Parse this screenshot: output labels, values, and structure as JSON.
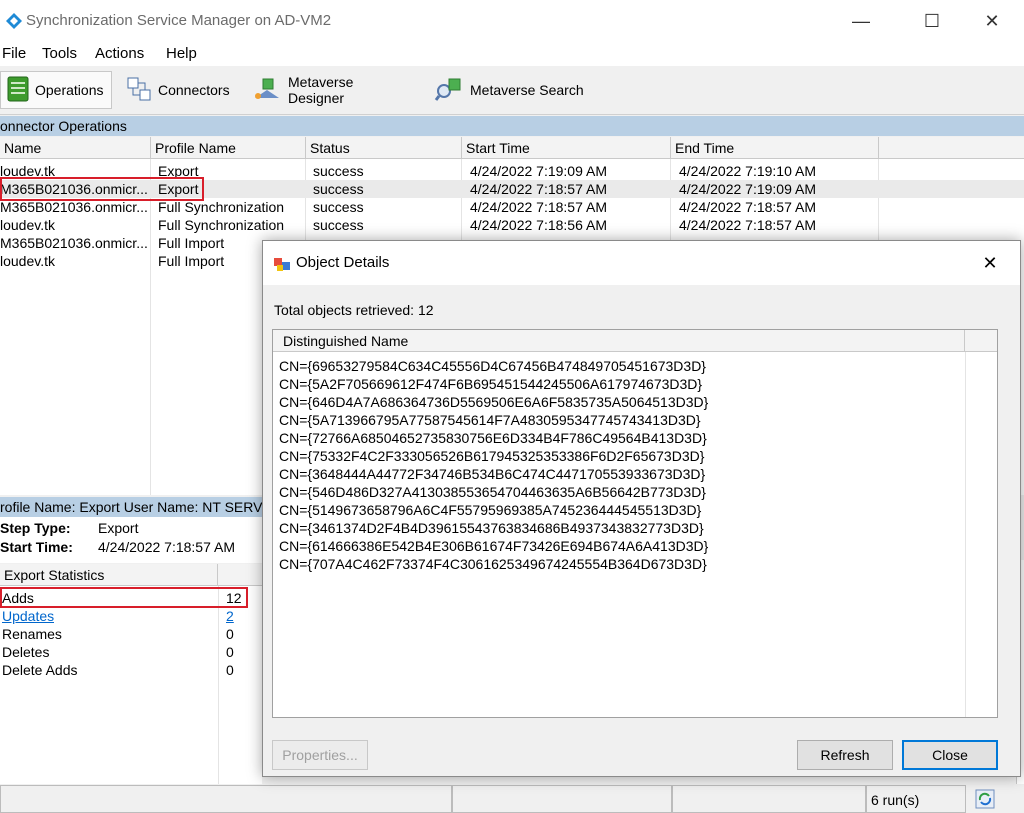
{
  "window": {
    "title": "Synchronization Service Manager on AD-VM2"
  },
  "menu": [
    "File",
    "Tools",
    "Actions",
    "Help"
  ],
  "toolbar": {
    "operations": "Operations",
    "connectors": "Connectors",
    "metaverse_designer": "Metaverse Designer",
    "metaverse_search": "Metaverse Search"
  },
  "connector_operations": {
    "header": "onnector Operations",
    "columns": [
      "Name",
      "Profile Name",
      "Status",
      "Start Time",
      "End Time"
    ],
    "rows": [
      [
        "loudev.tk",
        "Export",
        "success",
        "4/24/2022 7:19:09 AM",
        "4/24/2022 7:19:10 AM"
      ],
      [
        "M365B021036.onmicr...",
        "Export",
        "success",
        "4/24/2022 7:18:57 AM",
        "4/24/2022 7:19:09 AM"
      ],
      [
        "M365B021036.onmicr...",
        "Full Synchronization",
        "success",
        "4/24/2022 7:18:57 AM",
        "4/24/2022 7:18:57 AM"
      ],
      [
        "loudev.tk",
        "Full Synchronization",
        "success",
        "4/24/2022 7:18:56 AM",
        "4/24/2022 7:18:57 AM"
      ],
      [
        "M365B021036.onmicr...",
        "Full Import",
        "",
        "",
        ""
      ],
      [
        "loudev.tk",
        "Full Import",
        "",
        "",
        ""
      ]
    ]
  },
  "profile_details": {
    "header": "rofile Name: Export  User Name: NT SERV",
    "step_type_label": "Step Type:",
    "step_type_value": "Export",
    "start_time_label": "Start Time:",
    "start_time_value": "4/24/2022 7:18:57 AM"
  },
  "export_statistics": {
    "header": "Export Statistics",
    "rows": [
      {
        "label": "Adds",
        "value": "12"
      },
      {
        "label": "Updates",
        "value": "2"
      },
      {
        "label": "Renames",
        "value": "0"
      },
      {
        "label": "Deletes",
        "value": "0"
      },
      {
        "label": "Delete Adds",
        "value": "0"
      }
    ]
  },
  "status_bar": {
    "runs": "6 run(s)"
  },
  "dialog": {
    "title": "Object Details",
    "total_label": "Total objects retrieved: 12",
    "column": "Distinguished Name",
    "items": [
      "CN={69653279584C634C45556D4C67456B474849705451673D3D}",
      "CN={5A2F705669612F474F6B695451544245506A617974673D3D}",
      "CN={646D4A7A686364736D5569506E6A6F5835735A5064513D3D}",
      "CN={5A713966795A77587545614F7A4830595347745743413D3D}",
      "CN={72766A68504652735830756E6D334B4F786C49564B413D3D}",
      "CN={75332F4C2F333056526B617945325353386F6D2F65673D3D}",
      "CN={3648444A44772F34746B534B6C474C447170553933673D3D}",
      "CN={546D486D327A41303855365470446363​5A6B56642B773D3D}",
      "CN={5149673658796A6C4F55795969385A745236444545513D3D}",
      "CN={3461374D2F4B4D39615543763834686B4937343832773D3D}",
      "CN={614666386E542B4E306B61674F73426E694B674A6A413D3D}",
      "CN={707A4C462F73374F4C3061625349674245554B364D673D3D}"
    ],
    "properties_btn": "Properties...",
    "refresh_btn": "Refresh",
    "close_btn": "Close"
  }
}
